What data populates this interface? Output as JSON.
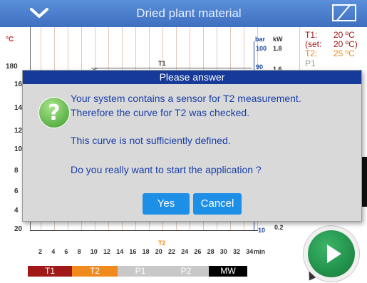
{
  "header": {
    "title": "Dried plant material",
    "menu_icon": "chevron-down-icon",
    "layout_icon": "split-view-icon"
  },
  "chart": {
    "y_left_unit": "°C",
    "y_left_ticks": [
      "180",
      "16",
      "14",
      "12",
      "10",
      "8",
      "6",
      "4",
      "20"
    ],
    "y_right_units": [
      "bar",
      "kW"
    ],
    "y_right_bar_ticks": [
      "100",
      "90",
      "10"
    ],
    "y_right_kw_ticks": [
      "1.8",
      "1.6",
      "0.2"
    ],
    "x_ticks": [
      "2",
      "4",
      "6",
      "8",
      "10",
      "12",
      "14",
      "16",
      "18",
      "20",
      "22",
      "24",
      "26",
      "28",
      "30",
      "32",
      "34"
    ],
    "x_unit": "min",
    "series_labels": [
      "T1",
      "T2"
    ]
  },
  "legend": [
    "T1",
    "T2",
    "P1",
    "P2",
    "MW"
  ],
  "status": {
    "t1_label": "T1:",
    "t1_value": "20 ºC",
    "set_label": "(set:",
    "set_value": "20 ºC)",
    "t2_label": "T2:",
    "t2_value": "25 ºC",
    "p1_label": "P1"
  },
  "dialog": {
    "title": "Please answer",
    "icon": "question-icon",
    "line1": "Your system contains a sensor for T2 measurement.",
    "line2": "Therefore the curve for T2 was checked.",
    "line3": "This curve is not sufficiently defined.",
    "line4": "Do you really want to start the application ?",
    "yes": "Yes",
    "cancel": "Cancel"
  },
  "colors": {
    "header": "#4a7fcf",
    "dialog_title": "#163a9a",
    "dialog_text": "#1a3fa8",
    "button": "#1e8fe6",
    "t1": "#a01818",
    "t2": "#f08a1c",
    "p1": "#c8c8c8",
    "p2": "#c8c8c8",
    "mw": "#000000",
    "play": "#1f9a4c"
  }
}
